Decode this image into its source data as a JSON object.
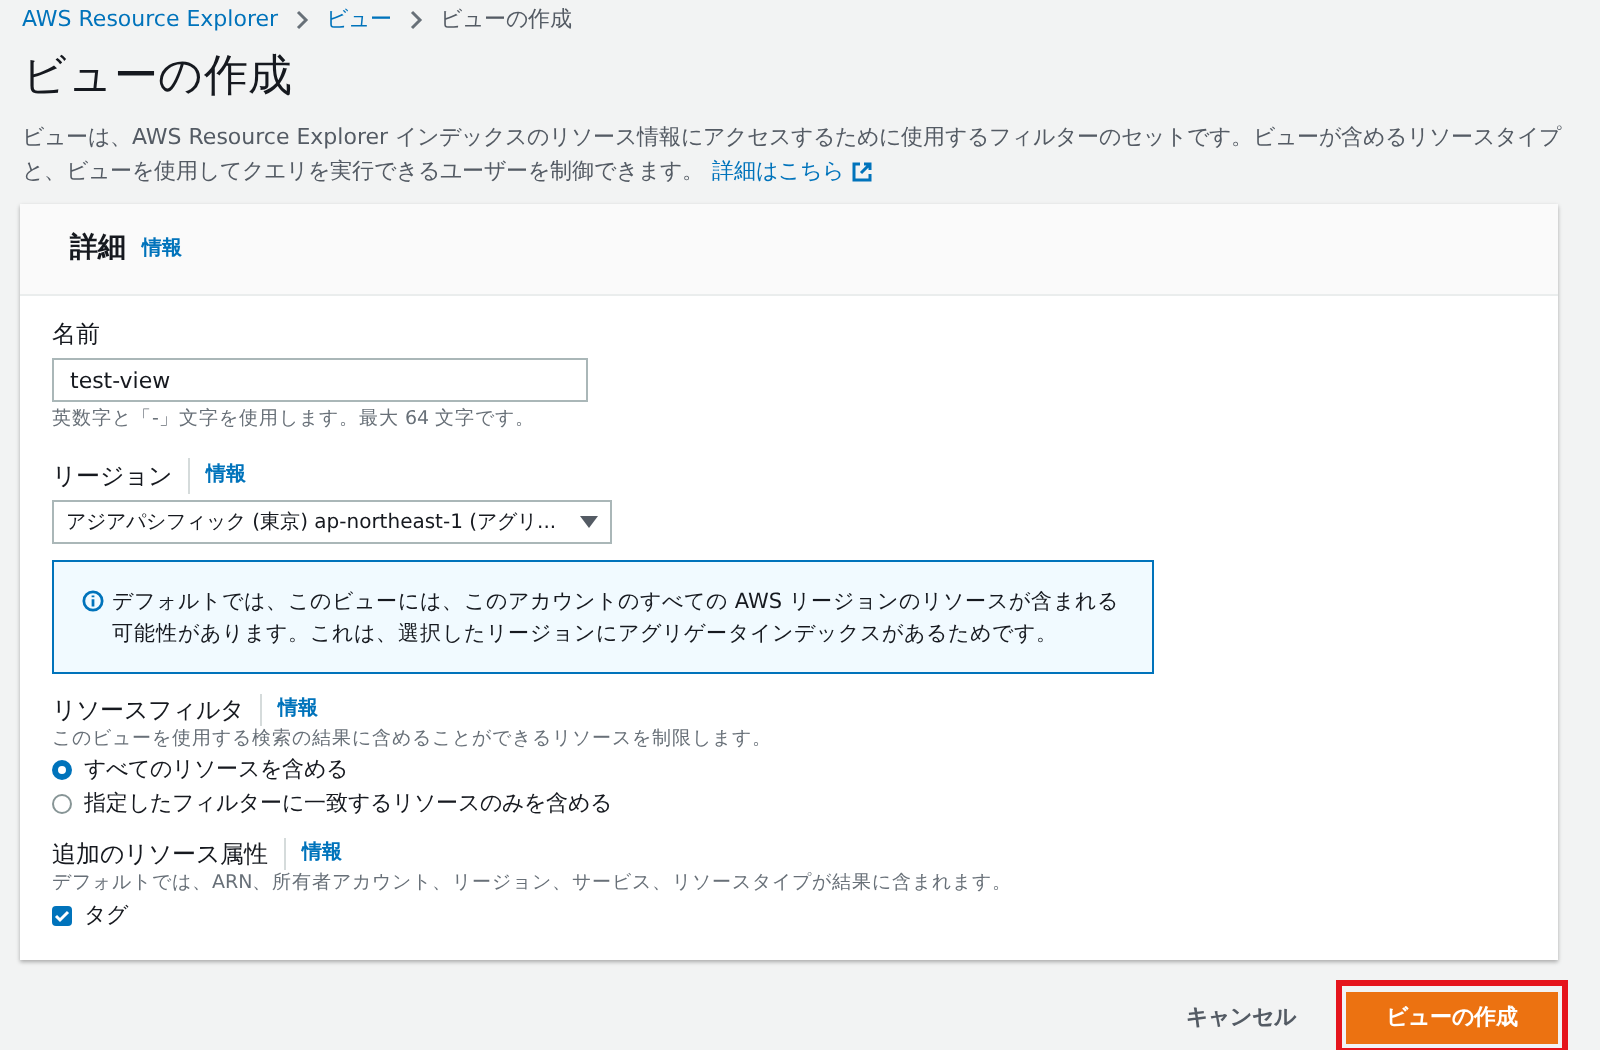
{
  "breadcrumbs": [
    {
      "label": "AWS Resource Explorer",
      "kind": "link"
    },
    {
      "label": "ビュー",
      "kind": "link"
    },
    {
      "label": "ビューの作成",
      "kind": "current"
    }
  ],
  "title": "ビューの作成",
  "description": {
    "text": "ビューは、AWS Resource Explorer インデックスのリソース情報にアクセスするために使用するフィルターのセットです。ビューが含めるリソースタイプと、ビューを使用してクエリを実行できるユーザーを制御できます。",
    "link": "詳細はこちら"
  },
  "card": {
    "title": "詳細",
    "info": "情報",
    "name_field": {
      "label": "名前",
      "value": "test-view",
      "hint": "英数字と「-」文字を使用します。最大 64 文字です。"
    },
    "region": {
      "label": "リージョン",
      "info": "情報",
      "value": "アジアパシフィック (東京) ap-northeast-1 (アグリ..."
    },
    "alert": "デフォルトでは、このビューには、このアカウントのすべての AWS リージョンのリソースが含まれる可能性があります。これは、選択したリージョンにアグリゲータインデックスがあるためです。",
    "resource_filter": {
      "label": "リソースフィルタ",
      "info": "情報",
      "description": "このビューを使用する検索の結果に含めることができるリソースを制限します。",
      "options": [
        {
          "label": "すべてのリソースを含める",
          "selected": true
        },
        {
          "label": "指定したフィルターに一致するリソースのみを含める",
          "selected": false
        }
      ]
    },
    "attributes": {
      "label": "追加のリソース属性",
      "info": "情報",
      "description": "デフォルトでは、ARN、所有者アカウント、リージョン、サービス、リソースタイプが結果に含まれます。",
      "checkbox": {
        "label": "タグ",
        "checked": true
      }
    }
  },
  "buttons": [
    {
      "label": "キャンセル",
      "kind": "secondary",
      "highlighted": false
    },
    {
      "label": "ビューの作成",
      "kind": "primary",
      "highlighted": true
    }
  ]
}
